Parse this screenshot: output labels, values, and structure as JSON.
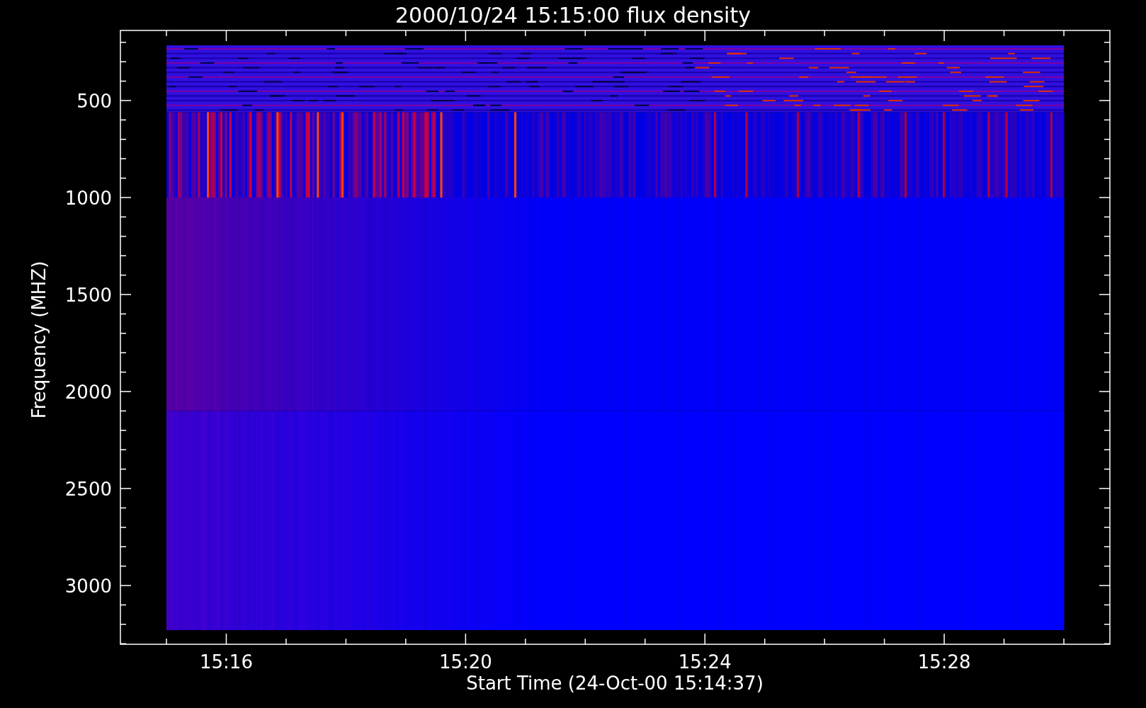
{
  "title": "2000/10/24 15:15:00 flux density",
  "y_axis": {
    "label": "Frequency (MHZ)",
    "ticks": [
      "500",
      "1000",
      "1500",
      "2000",
      "2500",
      "3000"
    ]
  },
  "x_axis": {
    "label": "Start Time (24-Oct-00 15:14:37)",
    "ticks": [
      "15:16",
      "15:20",
      "15:24",
      "15:28"
    ]
  }
}
